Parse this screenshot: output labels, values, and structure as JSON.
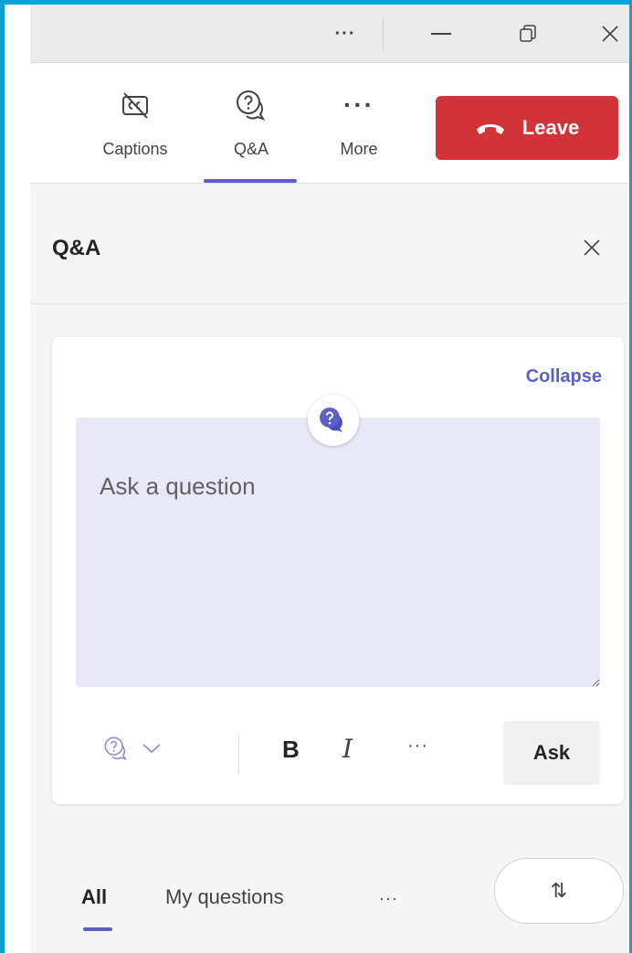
{
  "titlebar": {
    "more_glyph": "···"
  },
  "toolbar": {
    "items": [
      {
        "label": "Captions",
        "icon": "captions-off-icon"
      },
      {
        "label": "Q&A",
        "icon": "question-bubble-icon",
        "active": true
      },
      {
        "label": "More",
        "icon": "more-icon",
        "glyph": "···"
      }
    ],
    "leave_label": "Leave"
  },
  "panel": {
    "title": "Q&A"
  },
  "compose": {
    "collapse_label": "Collapse",
    "placeholder": "Ask a question",
    "value": "",
    "bold_glyph": "B",
    "italic_glyph": "I",
    "more_glyph": "···",
    "ask_label": "Ask"
  },
  "filters": {
    "tabs": [
      {
        "label": "All",
        "active": true
      },
      {
        "label": "My questions",
        "active": false
      }
    ],
    "more_glyph": "···",
    "sort_glyph": "⇅"
  },
  "colors": {
    "accent": "#5b5fc7",
    "leave": "#d13438",
    "frame": "#0ea0d8",
    "input_bg": "#e8e8f7"
  }
}
